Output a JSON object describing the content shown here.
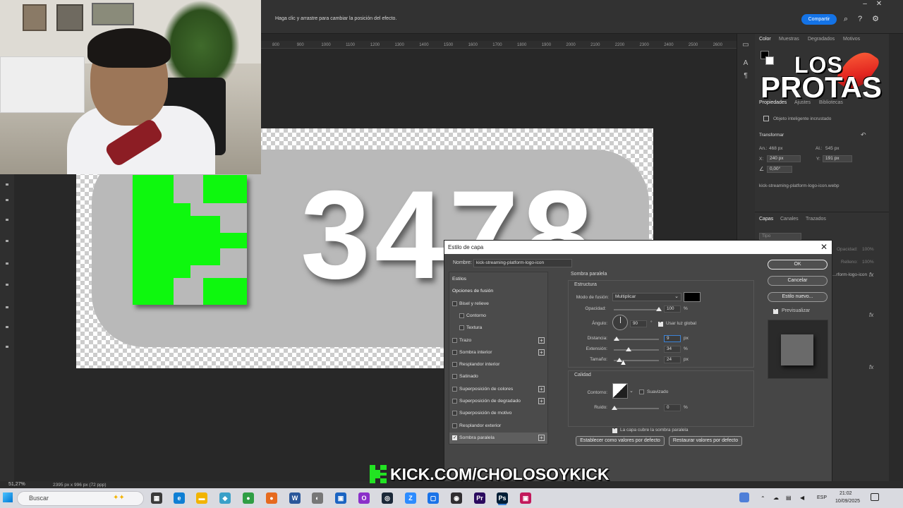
{
  "topbar": {
    "hint": "Haga clic y arrastre para cambiar la posición del efecto.",
    "share_label": "Compartir",
    "icons": [
      "search-icon",
      "help-icon",
      "gear-icon"
    ]
  },
  "ruler": [
    "800",
    "900",
    "1000",
    "1100",
    "1200",
    "1300",
    "1400",
    "1500",
    "1600",
    "1700",
    "1800",
    "1900",
    "2000",
    "2100",
    "2200",
    "2300",
    "2400",
    "2500",
    "2600"
  ],
  "canvas": {
    "counter_text": "3478",
    "logo_letter": "K"
  },
  "right_panel": {
    "color_tabs": [
      "Color",
      "Muestras",
      "Degradados",
      "Motivos"
    ],
    "overlay_line1": "LOS",
    "overlay_line2": "PROTAS",
    "props_tabs": [
      "Propiedades",
      "Ajustes",
      "Bibliotecas"
    ],
    "object_type": "Objeto inteligente incrustado",
    "transform_title": "Transformar",
    "w_label": "An.:",
    "w_value": "468 px",
    "h_label": "Al.:",
    "h_value": "545 px",
    "x_label": "X:",
    "x_value": "240 px",
    "y_label": "Y:",
    "y_value": "191 px",
    "angle_value": "0,00°",
    "filename": "kick-streaming-platform-logo-icon.webp",
    "layer_tabs": [
      "Capas",
      "Canales",
      "Trazados"
    ],
    "layer_search": "Tipo",
    "opacity_label": "Opacidad:",
    "opacity_value": "100%",
    "fill_label": "Relleno:",
    "fill_value": "100%",
    "layer_name": "...rform-logo-icon",
    "fx_label": "fx"
  },
  "dialog": {
    "title": "Estilo de capa",
    "name_label": "Nombre:",
    "name_value": "kick-streaming-platform-logo-icon",
    "styles": [
      {
        "label": "Estilos",
        "checkbox": false,
        "plus": false,
        "checked": false,
        "indent": 0,
        "header": true
      },
      {
        "label": "Opciones de fusión",
        "checkbox": false,
        "plus": false,
        "checked": false,
        "indent": 0,
        "header": true
      },
      {
        "label": "Bisel y relieve",
        "checkbox": true,
        "plus": false,
        "checked": false,
        "indent": 0
      },
      {
        "label": "Contorno",
        "checkbox": true,
        "plus": false,
        "checked": false,
        "indent": 1
      },
      {
        "label": "Textura",
        "checkbox": true,
        "plus": false,
        "checked": false,
        "indent": 1
      },
      {
        "label": "Trazo",
        "checkbox": true,
        "plus": true,
        "checked": false,
        "indent": 0
      },
      {
        "label": "Sombra interior",
        "checkbox": true,
        "plus": true,
        "checked": false,
        "indent": 0
      },
      {
        "label": "Resplandor interior",
        "checkbox": true,
        "plus": false,
        "checked": false,
        "indent": 0
      },
      {
        "label": "Satinado",
        "checkbox": true,
        "plus": false,
        "checked": false,
        "indent": 0
      },
      {
        "label": "Superposición de colores",
        "checkbox": true,
        "plus": true,
        "checked": false,
        "indent": 0
      },
      {
        "label": "Superposición de degradado",
        "checkbox": true,
        "plus": true,
        "checked": false,
        "indent": 0
      },
      {
        "label": "Superposición de motivo",
        "checkbox": true,
        "plus": false,
        "checked": false,
        "indent": 0
      },
      {
        "label": "Resplandor exterior",
        "checkbox": true,
        "plus": false,
        "checked": false,
        "indent": 0
      },
      {
        "label": "Sombra paralela",
        "checkbox": true,
        "plus": true,
        "checked": true,
        "indent": 0,
        "selected": true
      }
    ],
    "section_title": "Sombra paralela",
    "structure_title": "Estructura",
    "blend_label": "Modo de fusión:",
    "blend_value": "Multiplicar",
    "shadow_color": "#000000",
    "opacity_label": "Opacidad:",
    "opacity_value": "100",
    "angle_label": "Ángulo:",
    "angle_value": "90",
    "angle_unit": "°",
    "global_light_label": "Usar luz global",
    "distance_label": "Distancia:",
    "distance_value": "9",
    "spread_label": "Extensión:",
    "spread_value": "34",
    "size_label": "Tamaño:",
    "size_value": "24",
    "pct": "%",
    "px": "px",
    "quality_title": "Calidad",
    "contour_label": "Contorno:",
    "smooth_label": "Suavizado",
    "noise_label": "Ruido:",
    "noise_value": "0",
    "knockout_label": "La capa cubre la sombra paralela",
    "make_default": "Establecer como valores por defecto",
    "reset_default": "Restaurar valores por defecto",
    "ok": "OK",
    "cancel": "Cancelar",
    "new_style": "Estilo nuevo...",
    "preview_label": "Previsualizar"
  },
  "status": {
    "zoom": "51,27%",
    "doc": "2395 px x 996 px (72 ppp)"
  },
  "banner": {
    "text": "KICK.COM/CHOLOSOYKICK"
  },
  "taskbar": {
    "search_placeholder": "Buscar",
    "lang": "ESP",
    "time": "21:02",
    "date": "10/09/2025"
  }
}
